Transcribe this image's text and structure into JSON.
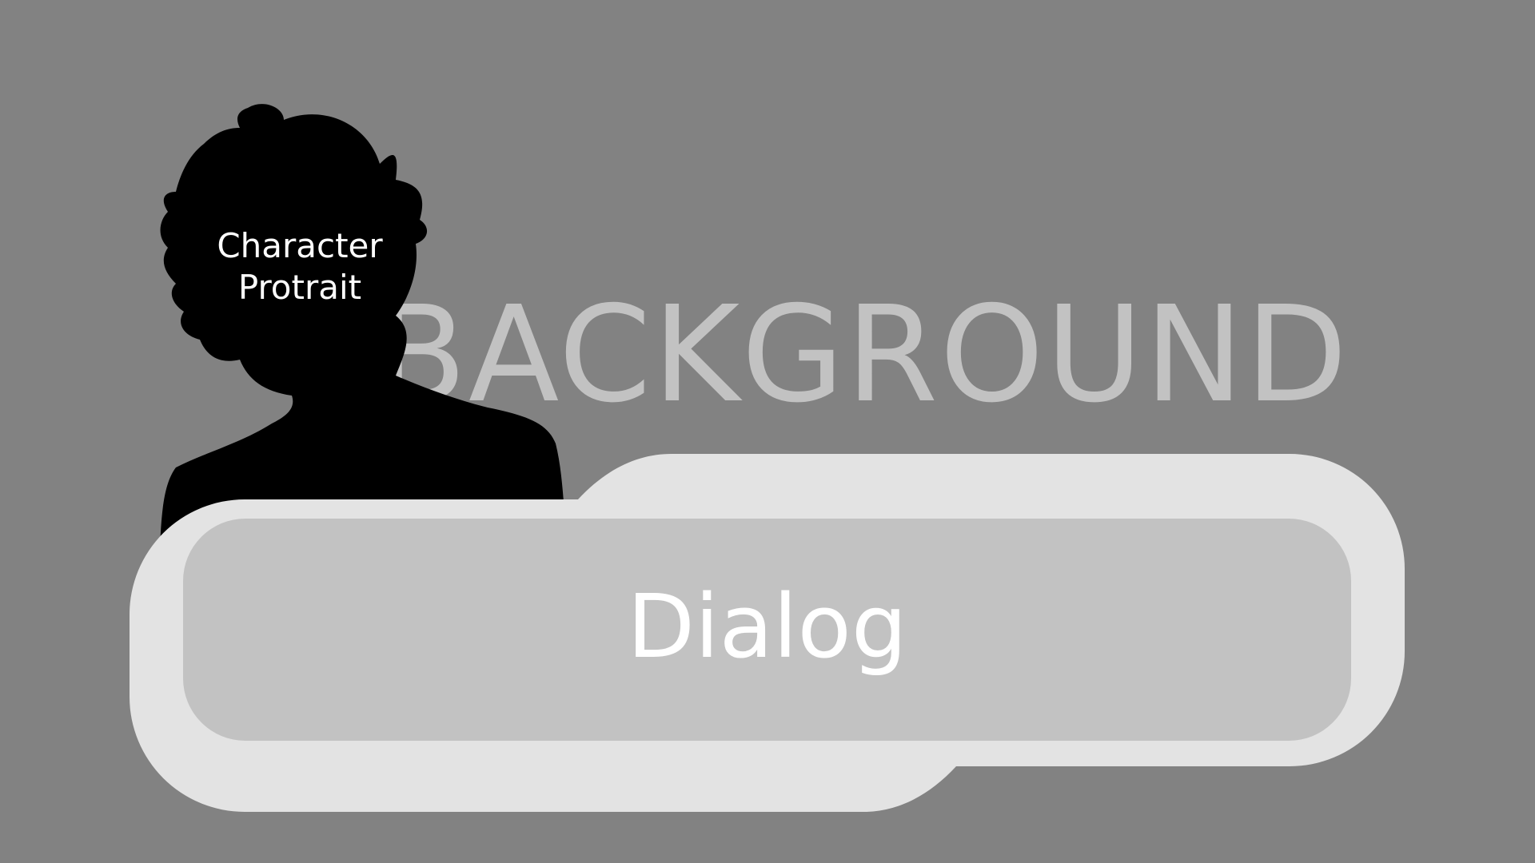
{
  "scene": {
    "background_label": "BACKGROUND",
    "portrait": {
      "label": "Character\nProtrait",
      "icon": "character-silhouette"
    },
    "dialog": {
      "text": "Dialog"
    }
  },
  "colors": {
    "background": "#828282",
    "background_text": "#c2c2c2",
    "silhouette": "#000000",
    "dialog_outer": "#e3e3e3",
    "dialog_inner": "#c2c2c2",
    "text_light": "#ffffff"
  }
}
